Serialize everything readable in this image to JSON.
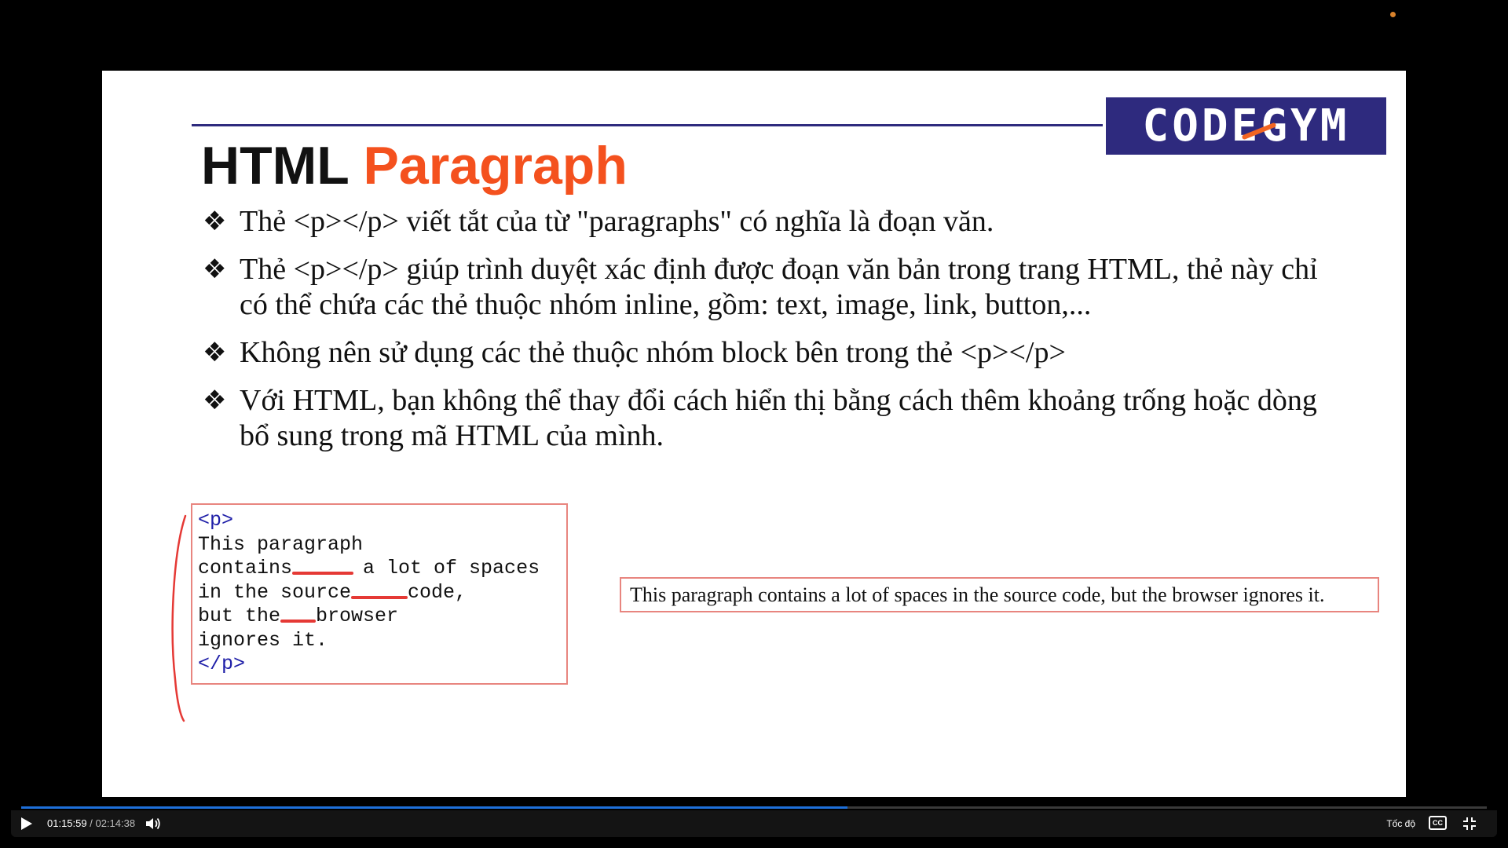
{
  "slide": {
    "logo": "CODEGYM",
    "title": {
      "main": "HTML",
      "accent": "Paragraph"
    },
    "bullets": [
      "Thẻ <p></p> viết tắt của từ \"paragraphs\" có nghĩa là đoạn văn.",
      "Thẻ <p></p> giúp trình duyệt xác định được đoạn văn bản trong trang HTML, thẻ này chỉ có thể chứa các thẻ thuộc nhóm inline, gồm: text, image, link, button,...",
      "Không nên sử dụng các thẻ thuộc nhóm block bên trong thẻ <p></p>",
      "Với HTML, bạn không thể thay đổi cách hiển thị bằng cách thêm khoảng trống hoặc dòng bổ sung trong mã HTML của mình."
    ],
    "bullet_mark": "❖",
    "code": {
      "open_tag": "<p>",
      "line1": "This paragraph",
      "line2a": "contains ",
      "line2b": "a lot of spaces",
      "line3a": "in the source ",
      "line3b": "code,",
      "line4a": "but the ",
      "line4b": "browser",
      "line5": "ignores it.",
      "close_tag": "</p>"
    },
    "output": "This paragraph contains a lot of spaces in the source code, but the browser ignores it.",
    "colors": {
      "brand": "#2e2a7e",
      "accent": "#f4511e",
      "annotation": "#e53935",
      "border": "#e8857f",
      "code_tag": "#1f1fa8"
    }
  },
  "player": {
    "current_time": "01:15:59",
    "separator": "/",
    "duration": "02:14:38",
    "progress": 0.564,
    "speed_label": "Tốc độ",
    "cc_label": "CC",
    "icons": [
      "play-icon",
      "volume-icon",
      "captions-icon",
      "exit-fullscreen-icon"
    ]
  }
}
